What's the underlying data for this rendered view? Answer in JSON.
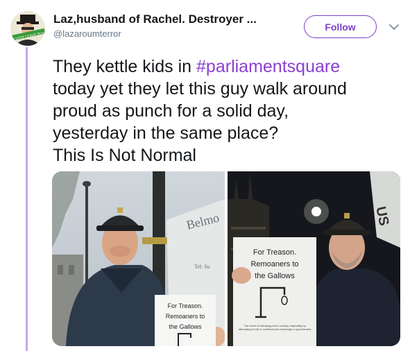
{
  "user": {
    "display_name": "Laz,husband of Rachel. Destroyer ...",
    "handle": "@lazaroumterror",
    "avatar_banner": "VOTE LEAVE 2016"
  },
  "follow_label": "Follow",
  "tweet": {
    "line1_prefix": "They kettle kids in ",
    "hashtag": "#parliamentsquare",
    "line2": "today yet they let this guy walk around",
    "line3": "proud as punch for a solid day,",
    "line4": "yesterday in the same place?",
    "line5": "This Is Not Normal"
  },
  "photo1": {
    "sign_lines": [
      "For Treason.",
      "Remoaners to",
      "the Gallows"
    ],
    "van_text": "Belmo",
    "van_small": "Tel: Su"
  },
  "photo2": {
    "sign_lines": [
      "For Treason.",
      "Remoaners to",
      "the Gallows"
    ],
    "sign_footer": "The crime of betraying one's country, especially by attempting to kill or overthrow the sovereign or government",
    "banner_text": "US"
  },
  "colors": {
    "accent": "#7b3fc4",
    "hashtag": "#8a3fd1",
    "thread_line": "#c5a8e8",
    "handle_gray": "#657786"
  }
}
